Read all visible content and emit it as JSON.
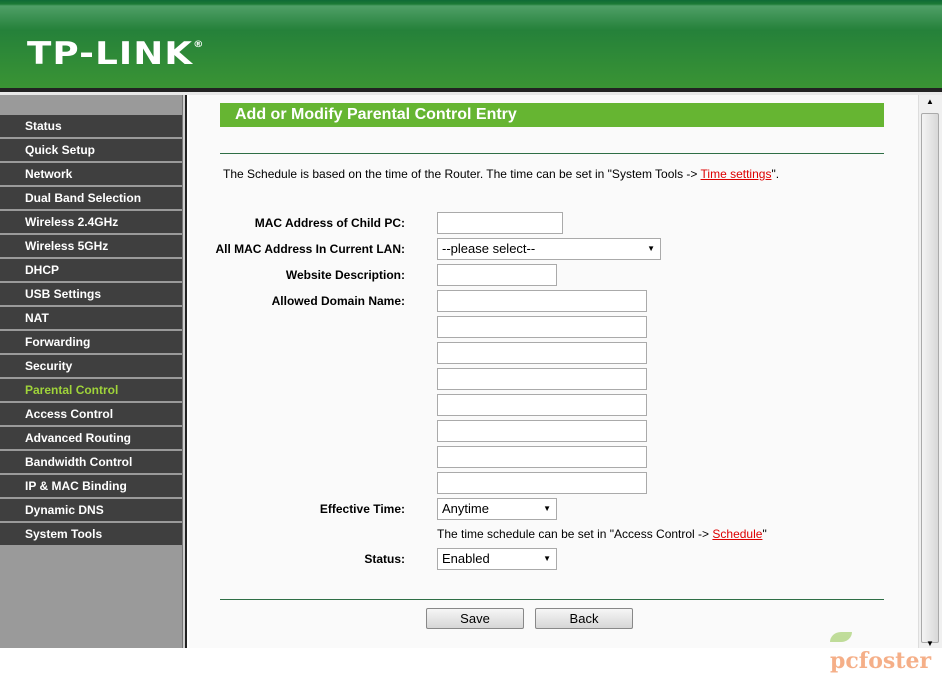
{
  "header": {
    "logo": "TP-LINK",
    "logo_mark": "®"
  },
  "sidebar": {
    "active": "Parental Control",
    "items": [
      {
        "label": "Status"
      },
      {
        "label": "Quick Setup"
      },
      {
        "label": "Network"
      },
      {
        "label": "Dual Band Selection"
      },
      {
        "label": "Wireless 2.4GHz"
      },
      {
        "label": "Wireless 5GHz"
      },
      {
        "label": "DHCP"
      },
      {
        "label": "USB Settings"
      },
      {
        "label": "NAT"
      },
      {
        "label": "Forwarding"
      },
      {
        "label": "Security"
      },
      {
        "label": "Parental Control"
      },
      {
        "label": "Access Control"
      },
      {
        "label": "Advanced Routing"
      },
      {
        "label": "Bandwidth Control"
      },
      {
        "label": "IP & MAC Binding"
      },
      {
        "label": "Dynamic DNS"
      },
      {
        "label": "System Tools"
      }
    ]
  },
  "main": {
    "title": "Add or Modify Parental Control Entry",
    "note_prefix": "The Schedule is based on the time of the Router. The time can be set in \"System Tools -> ",
    "note_link": "Time settings",
    "note_suffix": "\".",
    "mac_label": "MAC Address of Child PC:",
    "mac_value": "",
    "all_mac_label": "All MAC Address In Current LAN:",
    "all_mac_value": "--please select--",
    "website_label": "Website Description:",
    "website_value": "",
    "domain_label": "Allowed Domain Name:",
    "domains": [
      "",
      "",
      "",
      "",
      "",
      "",
      "",
      ""
    ],
    "effective_label": "Effective Time:",
    "effective_value": "Anytime",
    "sched_prefix": "The time schedule can be set in \"Access Control -> ",
    "sched_link": "Schedule",
    "sched_suffix": "\"",
    "status_label": "Status:",
    "status_value": "Enabled",
    "save": "Save",
    "back": "Back"
  },
  "colors": {
    "header_green": "#2a8a36",
    "title_green": "#66b532",
    "active_nav": "#9fd33a",
    "link": "#dd0000"
  },
  "watermark": "pcfoster"
}
